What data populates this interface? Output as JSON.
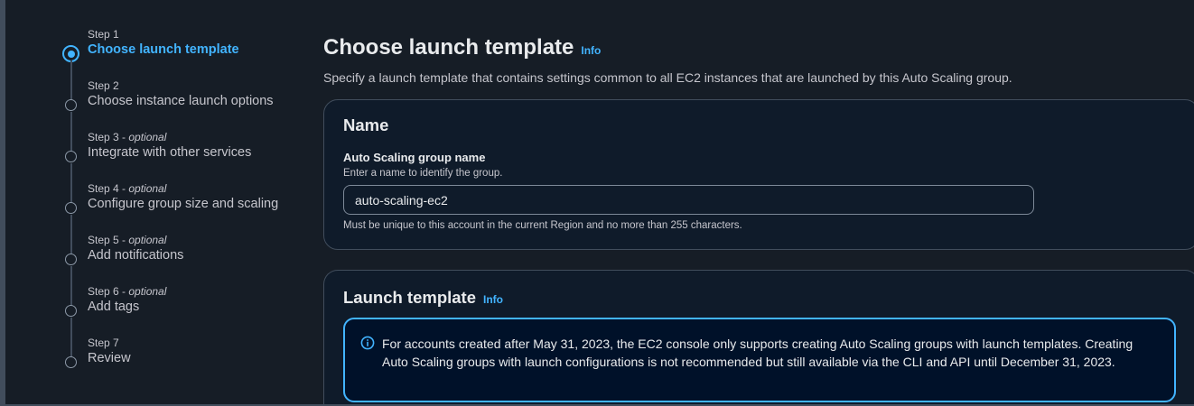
{
  "steps": [
    {
      "number": "Step 1",
      "optional": "",
      "title": "Choose launch template"
    },
    {
      "number": "Step 2",
      "optional": "",
      "title": "Choose instance launch options"
    },
    {
      "number": "Step 3 - ",
      "optional": "optional",
      "title": "Integrate with other services"
    },
    {
      "number": "Step 4 - ",
      "optional": "optional",
      "title": "Configure group size and scaling"
    },
    {
      "number": "Step 5 - ",
      "optional": "optional",
      "title": "Add notifications"
    },
    {
      "number": "Step 6 - ",
      "optional": "optional",
      "title": "Add tags"
    },
    {
      "number": "Step 7",
      "optional": "",
      "title": "Review"
    }
  ],
  "page": {
    "title": "Choose launch template",
    "info": "Info",
    "description": "Specify a launch template that contains settings common to all EC2 instances that are launched by this Auto Scaling group."
  },
  "name_section": {
    "title": "Name",
    "field_label": "Auto Scaling group name",
    "field_description": "Enter a name to identify the group.",
    "field_value": "auto-scaling-ec2",
    "constraint": "Must be unique to this account in the current Region and no more than 255 characters."
  },
  "launch_template_section": {
    "title": "Launch template",
    "info": "Info",
    "alert_text": "For accounts created after May 31, 2023, the EC2 console only supports creating Auto Scaling groups with launch templates. Creating Auto Scaling groups with launch configurations is not recommended but still available via the CLI and API until December 31, 2023."
  },
  "colors": {
    "accent": "#42b4ff",
    "background": "#161d26",
    "card": "#0f1b2a"
  }
}
